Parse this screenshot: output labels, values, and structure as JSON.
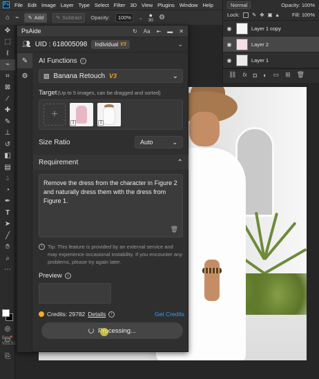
{
  "app": {
    "logo": "Ps",
    "menu": [
      "File",
      "Edit",
      "Image",
      "Layer",
      "Type",
      "Select",
      "Filter",
      "3D",
      "View",
      "Plugins",
      "Window",
      "Help"
    ]
  },
  "options_bar": {
    "add_label": "Add",
    "subtract_label": "Subtract",
    "opacity_label": "Opacity:",
    "opacity_value": "100%",
    "size_value": "30"
  },
  "layers_panel": {
    "blend_mode": "Normal",
    "opacity_label": "Opacity:",
    "opacity_value": "100%",
    "lock_label": "Lock:",
    "fill_label": "Fill:",
    "fill_value": "100%",
    "layers": [
      {
        "name": "Layer 1 copy",
        "selected": false
      },
      {
        "name": "Layer 2",
        "selected": true
      },
      {
        "name": "Layer 1",
        "selected": false
      }
    ]
  },
  "toolbar": {
    "version_label": "Beta",
    "version": "V25.3.0"
  },
  "plugin": {
    "title": "PsAide",
    "uid_text": "UID : 618005098",
    "plan": "Individual",
    "plan_badge": "V3",
    "ai_functions_label": "AI Functions",
    "function_name": "Banana Retouch",
    "function_version": "V3",
    "target_label": "Target",
    "target_hint": "(Up to 5 images, can be dragged and sorted)",
    "target_images": [
      {
        "index": "1"
      },
      {
        "index": "2"
      }
    ],
    "size_ratio_label": "Size Ratio",
    "size_ratio_value": "Auto",
    "requirement_label": "Requirement",
    "requirement_text": "Remove the dress from the character in Figure 2 and naturally dress them with the dress from Figure 1.",
    "tip_text": "Tip: This feature is provided by an external service and may experience occasional instability. If you encounter any problems, please try again later.",
    "preview_label": "Preview",
    "credits_label": "Credits: 29782",
    "details_label": "Details",
    "get_credits_label": "Get Credits",
    "processing_label": "Processing..."
  },
  "colors": {
    "accent_orange": "#f0a020",
    "link_blue": "#3d9bf0",
    "panel_bg": "#2f2f2f"
  }
}
